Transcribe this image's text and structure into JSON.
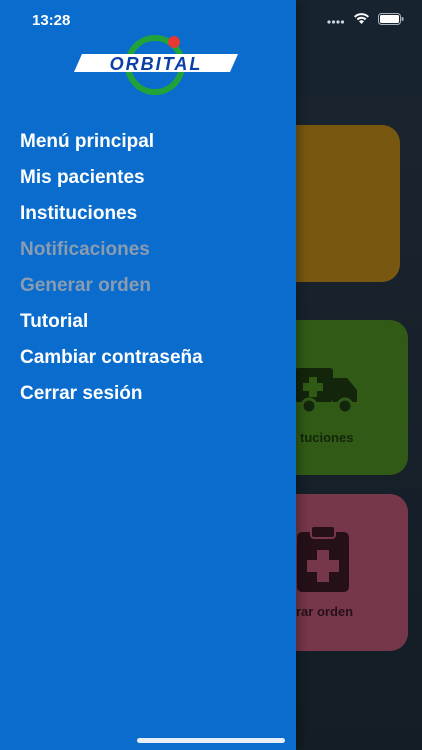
{
  "status_bar": {
    "time": "13:28"
  },
  "brand": {
    "logo_text": "ORBITAL",
    "primary": "#0a6ccd",
    "disabled": "#8a9cb0"
  },
  "menu": {
    "items": [
      {
        "label": "Menú principal",
        "enabled": true
      },
      {
        "label": "Mis pacientes",
        "enabled": true
      },
      {
        "label": "Instituciones",
        "enabled": true
      },
      {
        "label": "Notificaciones",
        "enabled": false
      },
      {
        "label": "Generar orden",
        "enabled": false
      },
      {
        "label": "Tutorial",
        "enabled": true
      },
      {
        "label": "Cambiar contraseña",
        "enabled": true
      },
      {
        "label": "Cerrar sesión",
        "enabled": true
      }
    ]
  },
  "background": {
    "cards": [
      {
        "name": "orange-card",
        "color": "#b8861a",
        "label": ""
      },
      {
        "name": "instituciones-card",
        "color": "#4a8a23",
        "label": "tuciones",
        "icon": "ambulance-icon"
      },
      {
        "name": "generar-orden-card",
        "color": "#b45570",
        "label": "rar orden",
        "icon": "clipboard-plus-icon"
      }
    ]
  }
}
